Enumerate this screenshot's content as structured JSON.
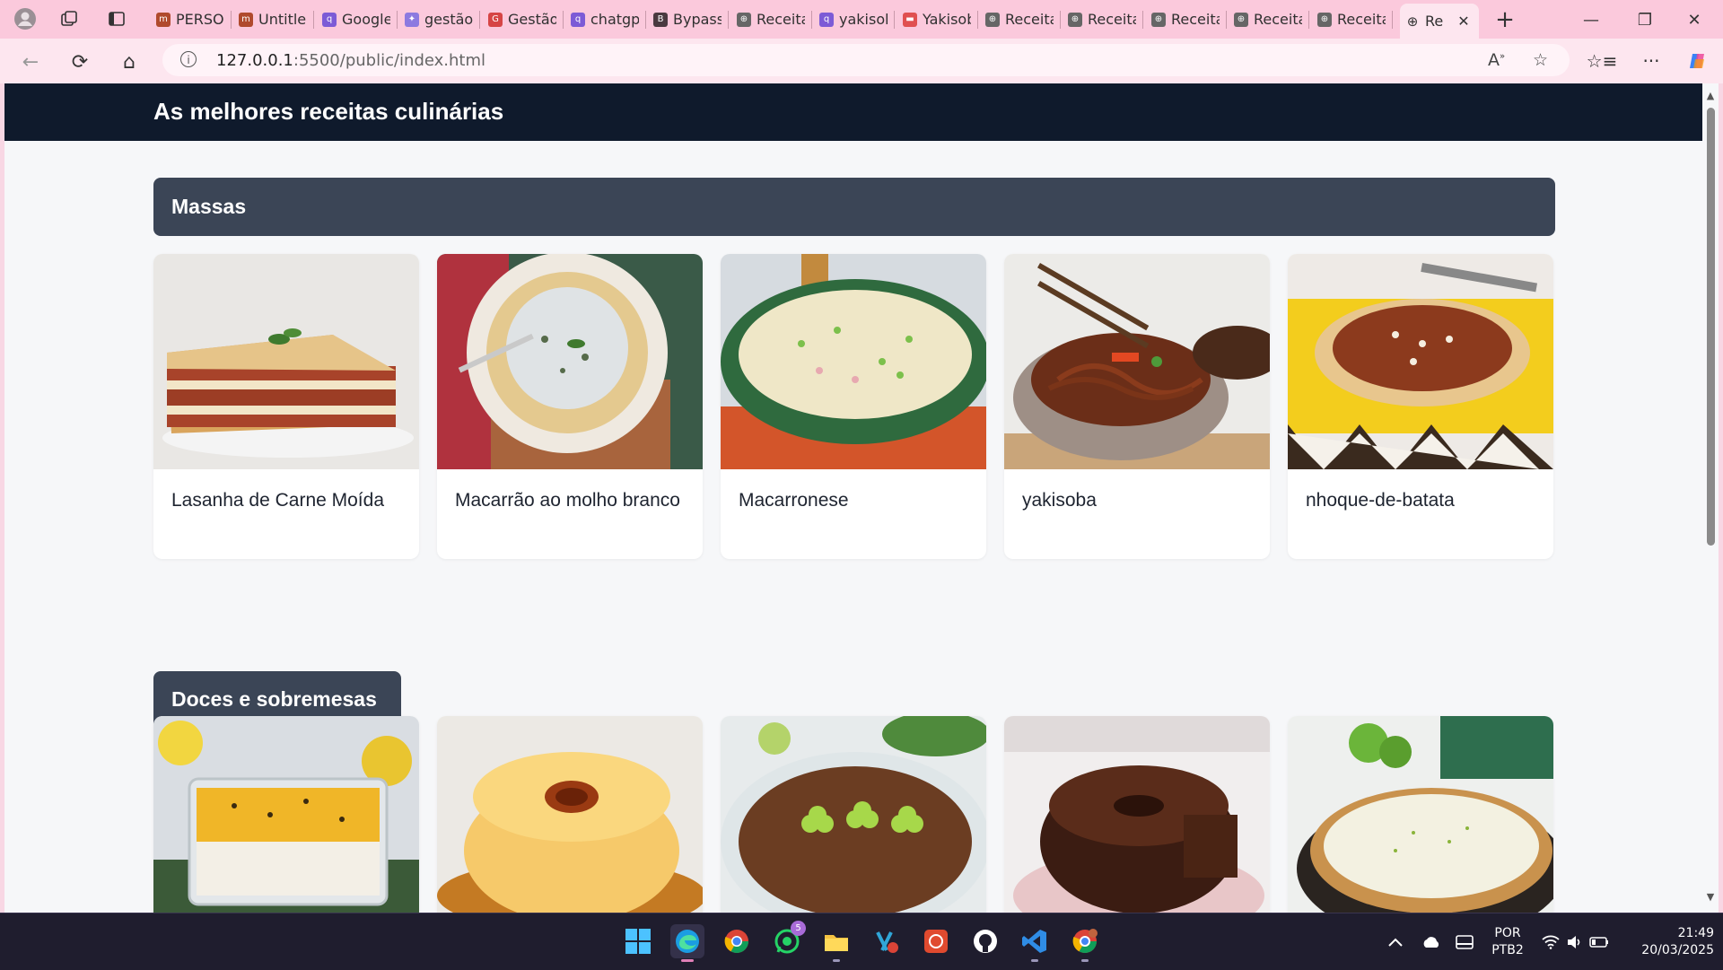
{
  "browser": {
    "tabs": [
      {
        "label": "PERSON",
        "fav": "m",
        "favcolor": "#b04a2d"
      },
      {
        "label": "Untitled",
        "fav": "m",
        "favcolor": "#b04a2d"
      },
      {
        "label": "Google",
        "fav": "q",
        "favcolor": "#7c5bd6"
      },
      {
        "label": "gestão",
        "fav": "✦",
        "favcolor": "#8c7ae0"
      },
      {
        "label": "Gestão",
        "fav": "G",
        "favcolor": "#d64545"
      },
      {
        "label": "chatgp",
        "fav": "q",
        "favcolor": "#7c5bd6"
      },
      {
        "label": "Bypass",
        "fav": "B",
        "favcolor": "#4a3a40"
      },
      {
        "label": "Receita",
        "fav": "⊕",
        "favcolor": "#666"
      },
      {
        "label": "yakisob",
        "fav": "q",
        "favcolor": "#7c5bd6"
      },
      {
        "label": "Yakisob",
        "fav": "▬",
        "favcolor": "#e05050"
      },
      {
        "label": "Receita",
        "fav": "⊕",
        "favcolor": "#666"
      },
      {
        "label": "Receita",
        "fav": "⊕",
        "favcolor": "#666"
      },
      {
        "label": "Receita",
        "fav": "⊕",
        "favcolor": "#666"
      },
      {
        "label": "Receita",
        "fav": "⊕",
        "favcolor": "#666"
      },
      {
        "label": "Receita",
        "fav": "⊕",
        "favcolor": "#666"
      }
    ],
    "active_tab": {
      "label": "Re"
    },
    "url_host": "127.0.0.1",
    "url_rest": ":5500/public/index.html"
  },
  "page": {
    "title": "As melhores receitas culinárias",
    "sections": [
      {
        "name": "Massas",
        "recipes": [
          {
            "title": "Lasanha de Carne Moída"
          },
          {
            "title": "Macarrão ao molho branco"
          },
          {
            "title": "Macarronese"
          },
          {
            "title": "yakisoba"
          },
          {
            "title": "nhoque-de-batata"
          }
        ]
      },
      {
        "name": "Doces e sobremesas",
        "recipes": [
          {
            "title": ""
          },
          {
            "title": ""
          },
          {
            "title": ""
          },
          {
            "title": ""
          },
          {
            "title": ""
          }
        ]
      }
    ]
  },
  "taskbar": {
    "whatsapp_badge": "5",
    "lang_line1": "POR",
    "lang_line2": "PTB2",
    "time": "21:49",
    "date": "20/03/2025"
  },
  "colors": {
    "header_bg": "#0f1a2c",
    "section_bar": "#3b4556",
    "chrome_tab_bg": "#fbc9dc",
    "chrome_addr_bg": "#fde6ef",
    "taskbar_bg": "#1f1d2e"
  }
}
